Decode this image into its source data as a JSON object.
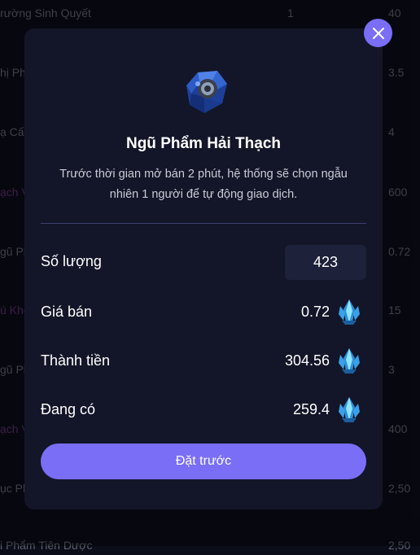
{
  "background_list": [
    {
      "name": "rường Sinh Quyết",
      "qty": "1",
      "price": "40"
    },
    {
      "name": "hị Phẩm",
      "qty": "",
      "price": "3.5"
    },
    {
      "name": "ạ Cấp",
      "qty": "",
      "price": "4"
    },
    {
      "name": "ạch Vi",
      "qty": "",
      "price": "600"
    },
    {
      "name": "gũ Ph",
      "qty": "",
      "price": "0.72"
    },
    {
      "name": "ú Khe",
      "qty": "",
      "price": "15"
    },
    {
      "name": "gũ Ph",
      "qty": "",
      "price": "3"
    },
    {
      "name": "ạch Vi",
      "qty": "",
      "price": "400"
    },
    {
      "name": "ục Ph",
      "qty": "",
      "price": "2,50"
    },
    {
      "name": "i Phẩm Tiên Dược",
      "qty": "",
      "price": "2,50"
    }
  ],
  "modal": {
    "item_name": "Ngũ Phẩm Hải Thạch",
    "description": "Trước thời gian mở bán 2 phút, hệ thống sẽ chọn ngẫu nhiên 1 người để tự động giao dịch.",
    "quantity_label": "Số lượng",
    "quantity_value": "423",
    "price_label": "Giá bán",
    "price_value": "0.72",
    "total_label": "Thành tiền",
    "total_value": "304.56",
    "balance_label": "Đang có",
    "balance_value": "259.4",
    "submit_label": "Đặt trước",
    "currency_icon": "blue-crystal-icon",
    "close_icon": "close-icon"
  },
  "colors": {
    "accent": "#7a6ef7",
    "modal_bg": "#131628",
    "input_bg": "#1d2139",
    "divider": "#3c4170"
  }
}
